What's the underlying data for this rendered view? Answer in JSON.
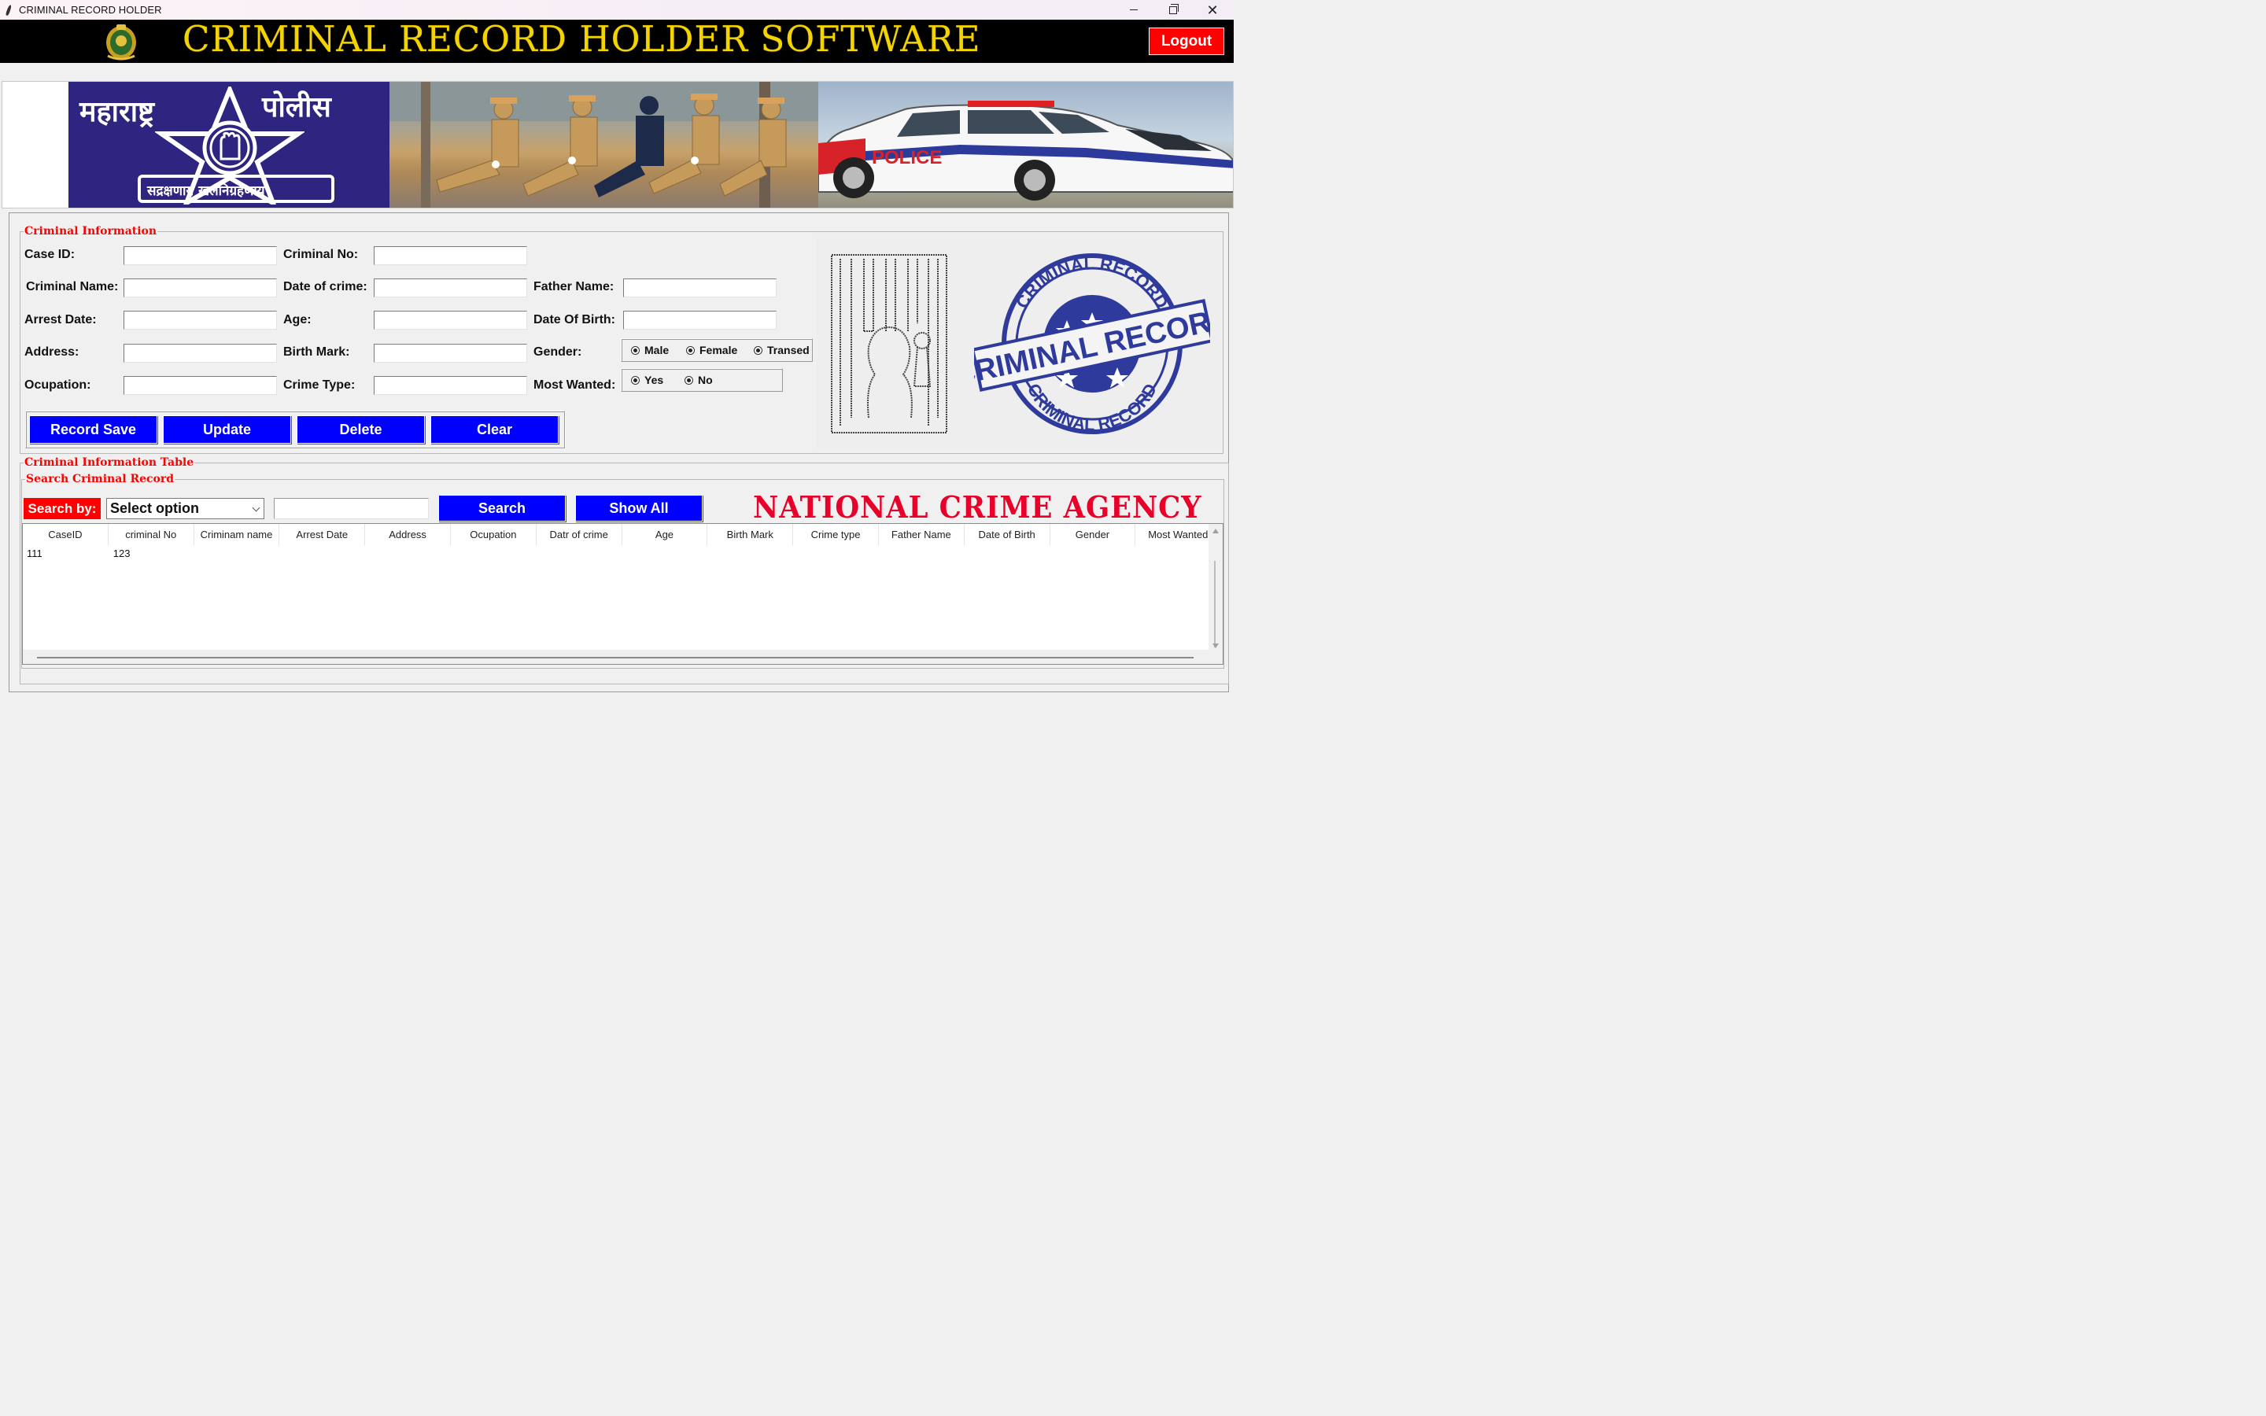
{
  "window": {
    "title": "CRIMINAL RECORD HOLDER"
  },
  "header": {
    "title": "CRIMINAL RECORD HOLDER SOFTWARE",
    "logout_label": "Logout"
  },
  "banner": {
    "logo_text_left": "महाराष्ट्र",
    "logo_text_right": "पोलीस",
    "logo_motto": "सद्रक्षणाय खलनिग्रहणाय",
    "car_text": "POLICE"
  },
  "criminal_info": {
    "legend": "Criminal Information",
    "labels": {
      "case_id": "Case ID:",
      "criminal_no": "Criminal No:",
      "criminal_name": "Criminal Name:",
      "date_of_crime": "Date of crime:",
      "father_name": "Father Name:",
      "arrest_date": "Arrest Date:",
      "age": "Age:",
      "date_of_birth": "Date Of Birth:",
      "address": "Address:",
      "birth_mark": "Birth Mark:",
      "gender": "Gender:",
      "ocupation": "Ocupation:",
      "crime_type": "Crime Type:",
      "most_wanted": "Most Wanted:"
    },
    "values": {
      "case_id": "",
      "criminal_no": "",
      "criminal_name": "",
      "date_of_crime": "",
      "father_name": "",
      "arrest_date": "",
      "age": "",
      "date_of_birth": "",
      "address": "",
      "birth_mark": "",
      "ocupation": "",
      "crime_type": ""
    },
    "gender_options": [
      "Male",
      "Female",
      "Transed"
    ],
    "most_wanted_options": [
      "Yes",
      "No"
    ],
    "buttons": {
      "save": "Record Save",
      "update": "Update",
      "delete": "Delete",
      "clear": "Clear"
    },
    "stamp_top": "CRIMINAL RECORD",
    "stamp_middle": "CRIMINAL RECORD",
    "stamp_bottom": "CRIMINAL RECORD"
  },
  "table_section": {
    "legend": "Criminal Information Table",
    "search_legend": "Search Criminal Record",
    "search_by_label": "Search by:",
    "select_value": "Select option",
    "search_value": "",
    "search_button": "Search",
    "show_all_button": "Show All",
    "agency": "NATIONAL CRIME AGENCY",
    "columns": [
      "CaseID",
      "criminal No",
      "Criminam name",
      "Arrest Date",
      "Address",
      "Ocupation",
      "Datr of crime",
      "Age",
      "Birth Mark",
      "Crime type",
      "Father Name",
      "Date of Birth",
      "Gender",
      "Most Wanted"
    ],
    "rows": [
      [
        "111",
        "123",
        "",
        "",
        "",
        "",
        "",
        "",
        "",
        "",
        "",
        "",
        "",
        ""
      ]
    ]
  },
  "colors": {
    "header_bg": "#000000",
    "title_yellow": "#f4d400",
    "accent_red": "#ff0000",
    "button_blue": "#0000ff",
    "legend_red": "#ff0000",
    "agency_red": "#e8002a"
  }
}
